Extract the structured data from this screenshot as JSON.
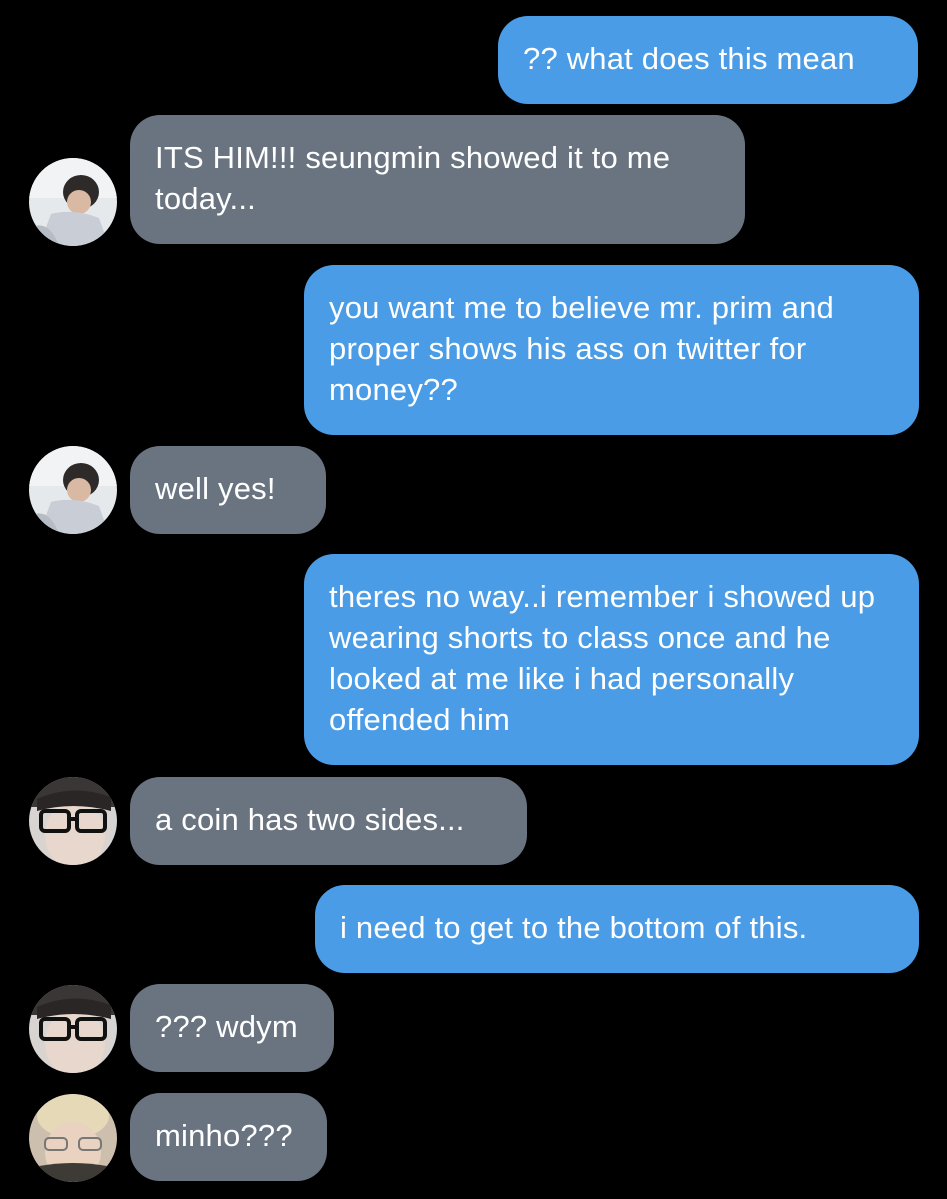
{
  "messages": [
    {
      "id": "m1",
      "direction": "outgoing",
      "text": "?? what does this mean"
    },
    {
      "id": "m2",
      "direction": "incoming",
      "sender_avatar": "avatar-a",
      "text": "ITS HIM!!! seungmin showed it to me today..."
    },
    {
      "id": "m3",
      "direction": "outgoing",
      "text": "you want me to believe mr. prim and proper shows his ass on twitter for money??"
    },
    {
      "id": "m4",
      "direction": "incoming",
      "sender_avatar": "avatar-a",
      "text": "well yes!"
    },
    {
      "id": "m5",
      "direction": "outgoing",
      "text": "theres no way..i remember i showed up wearing shorts to class once and he looked at me like i had personally offended him"
    },
    {
      "id": "m6",
      "direction": "incoming",
      "sender_avatar": "avatar-b",
      "text": "a coin has two sides..."
    },
    {
      "id": "m7",
      "direction": "outgoing",
      "text": "i need to get to the bottom of this."
    },
    {
      "id": "m8",
      "direction": "incoming",
      "sender_avatar": "avatar-b",
      "text": "??? wdym"
    },
    {
      "id": "m9",
      "direction": "incoming",
      "sender_avatar": "avatar-c",
      "text": "minho???"
    }
  ],
  "colors": {
    "background": "#000000",
    "outgoing_bubble": "#4a9ce6",
    "incoming_bubble": "#6a7480",
    "bubble_text": "#ffffff"
  },
  "icons": {
    "avatar-a": "person-photo-avatar",
    "avatar-b": "glasses-person-avatar",
    "avatar-c": "blond-person-avatar"
  }
}
